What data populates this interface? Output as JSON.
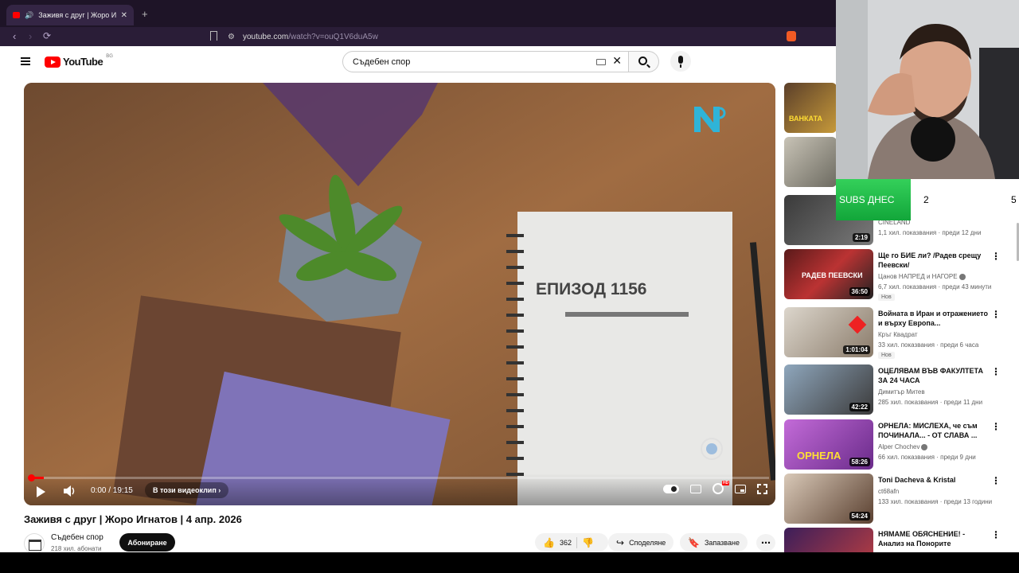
{
  "browser": {
    "tab_title": "Заживя с друг | Жоро Игнатов",
    "tab_close": "✕",
    "new_tab": "+",
    "url_host": "youtube.com",
    "url_path": "/watch?v=ouQ1V6duA5w",
    "nav_back": "‹",
    "nav_forward": "›",
    "reload": "⟳"
  },
  "header": {
    "logo_text": "YouTube",
    "country": "BG",
    "search_value": "Съдебен спор",
    "clear": "✕"
  },
  "player": {
    "episode_text": "ЕПИЗОД 1156",
    "time": "0:00 / 19:15",
    "chapter_label": "В този видеоклип",
    "chapter_arrow": "›",
    "progress": 0.018
  },
  "video": {
    "title": "Заживя с друг | Жоро Игнатов | 4 апр. 2026",
    "channel": "Съдебен спор",
    "subscribers": "218 хил. абонати",
    "subscribe_label": "Абониране",
    "likes": "362",
    "share_label": "Споделяне",
    "save_label": "Запазване",
    "more": "⋯"
  },
  "sidebar": {
    "items": [
      {
        "title": "",
        "channel": "",
        "meta": "",
        "duration": "",
        "thumb_text": "ВАНКАТА"
      },
      {
        "title": "",
        "channel": "",
        "meta": "",
        "duration": "",
        "thumb_text": ""
      },
      {
        "title": "",
        "channel": "CINELAND",
        "meta": "1,1 хил. показвания · преди 12 дни",
        "duration": "2:19",
        "thumb_text": ""
      },
      {
        "title": "Ще го БИЕ ли? /Радев срещу Пеевски/",
        "channel": "Цанов НАПРЕД и НАГОРЕ",
        "meta": "6,7 хил. показвания · преди 43 минути",
        "badge": "Нов",
        "duration": "36:50",
        "thumb_text": "РАДЕВ ПЕЕВСКИ"
      },
      {
        "title": "Войната в Иран и отражението и върху Европа...",
        "channel": "Кръг Квадрат",
        "meta": "33 хил. показвания · преди 6 часа",
        "badge": "Нов",
        "duration": "1:01:04",
        "thumb_text": ""
      },
      {
        "title": "ОЦЕЛЯВАМ ВЪВ ФАКУЛТЕТА ЗА 24 ЧАСА",
        "channel": "Димитър Митев",
        "meta": "285 хил. показвания · преди 11 дни",
        "duration": "42:22",
        "thumb_text": ""
      },
      {
        "title": "ОРНЕЛА: МИСЛЕХА, че съм ПОЧИНАЛА... - ОТ СЛАВА ...",
        "channel": "Alper Chochev",
        "meta": "66 хил. показвания · преди 9 дни",
        "duration": "58:26",
        "thumb_text": "ОРНЕЛА"
      },
      {
        "title": "Toni Dacheva & Kristal",
        "channel": "ct68afn",
        "meta": "133 хил. показвания · преди 13 години",
        "duration": "54:24",
        "thumb_text": ""
      },
      {
        "title": "НЯМАМЕ ОБЯСНЕНИЕ! - Анализ на Понорите",
        "channel": "",
        "meta": "",
        "duration": "",
        "thumb_text": ""
      }
    ]
  },
  "overlay": {
    "subs_label": "SUBS ДНЕС",
    "subs_value_1": "2",
    "subs_value_2": "5"
  },
  "colors": {
    "yt_red": "#ff0000",
    "browser_bg": "#1e1427",
    "subs_green": "#22c04a"
  }
}
